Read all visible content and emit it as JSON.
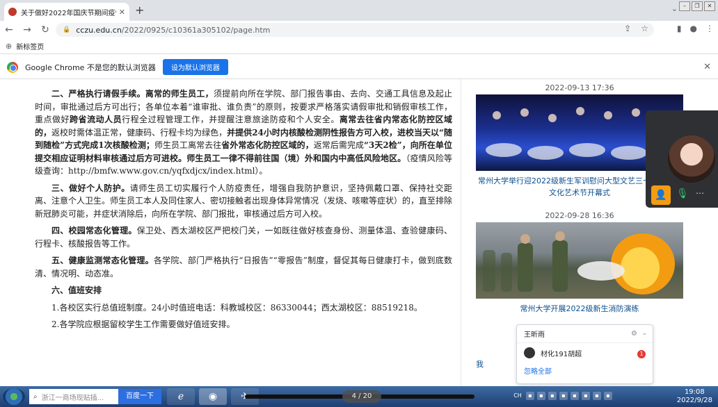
{
  "browser": {
    "tab_title": "关于做好2022年国庆节期间疫情...",
    "new_tab_symbol": "+",
    "url_host": "cczu.edu.cn",
    "url_path": "/2022/0925/c10361a305102/page.htm",
    "bookmark": "新标签页",
    "infobar_text": "Google Chrome 不是您的默认浏览器",
    "infobar_button": "设为默认浏览器"
  },
  "article": {
    "sec2_heading": "二、严格执行请假手续。",
    "sec2_b1": "离常的师生员工，",
    "sec2_t1": "须提前向所在学院、部门报告事由、去向、交通工具信息及起止时间，审批通过后方可出行；各单位本着“谁审批、谁负责”的原则，按要求严格落实请假审批和销假审核工作，重点做好",
    "sec2_b2": "跨省流动人员",
    "sec2_t2": "行程全过程管理工作，并提醒注意旅途防疫和个人安全。",
    "sec2_b3": "离常去往省内常态化防控区域的，",
    "sec2_t3": "返校时需体温正常，健康码、行程卡均为绿色，",
    "sec2_b4": "并提供24小时内核酸检测阴性报告方可入校，进校当天以“随到随检”方式完成1次核酸检测；",
    "sec2_t4": "师生员工离常去往",
    "sec2_b5": "省外常态化防控区域的，",
    "sec2_t5": "返常后需完成",
    "sec2_b6": "“3天2检”，向所在单位提交相应证明材料审核通过后方可进校。师生员工一律不得前往国（境）外和国内中高低风险地区。",
    "sec2_t6": "（疫情风险等级查询：http://bmfw.www.gov.cn/yqfxdjcx/index.html）。",
    "sec3_heading": "三、做好个人防护。",
    "sec3_text": "请师生员工切实履行个人防疫责任，增强自我防护意识，坚持佩戴口罩、保持社交距离、注意个人卫生。师生员工本人及同住家人、密切接触者出现身体异常情况（发烧、咳嗽等症状）的，直至排除新冠肺炎可能，并症状消除后，向所在学院、部门报批，审核通过后方可入校。",
    "sec4_heading": "四、校园常态化管理。",
    "sec4_text": "保卫处、西太湖校区严把校门关，一如既往做好核查身份、测量体温、查验健康码、行程卡、核酸报告等工作。",
    "sec5_heading": "五、健康监测常态化管理。",
    "sec5_text": "各学院、部门严格执行“日报告”“零报告”制度，督促其每日健康打卡，做到底数清、情况明、动态准。",
    "sec6_heading": "六、值班安排",
    "sec6_item1": "1.各校区实行总值班制度。24小时值班电话：科教城校区：86330044；西太湖校区：88519218。",
    "sec6_item2": "2.各学院应根据留校学生工作需要做好值班安排。"
  },
  "news": [
    {
      "date": "2022-09-13 17:36",
      "caption": "常州大学举行迎2022级新生军训慰问大型文艺三十八届校园文化艺术节开幕式"
    },
    {
      "date": "2022-09-28 16:36",
      "caption": "常州大学开展2022级新生消防演练"
    }
  ],
  "news_more_link": "我",
  "chat": {
    "name": "王昕雨",
    "contact": "材化191胡超",
    "badge": "1",
    "ignore_all": "忽略全部"
  },
  "taskbar": {
    "search_placeholder": "浙江一商场现贴插...",
    "baidu_button": "百度一下",
    "media_time": "4 / 20",
    "lang": "CH",
    "time": "19:08",
    "date": "2022/9/28"
  }
}
